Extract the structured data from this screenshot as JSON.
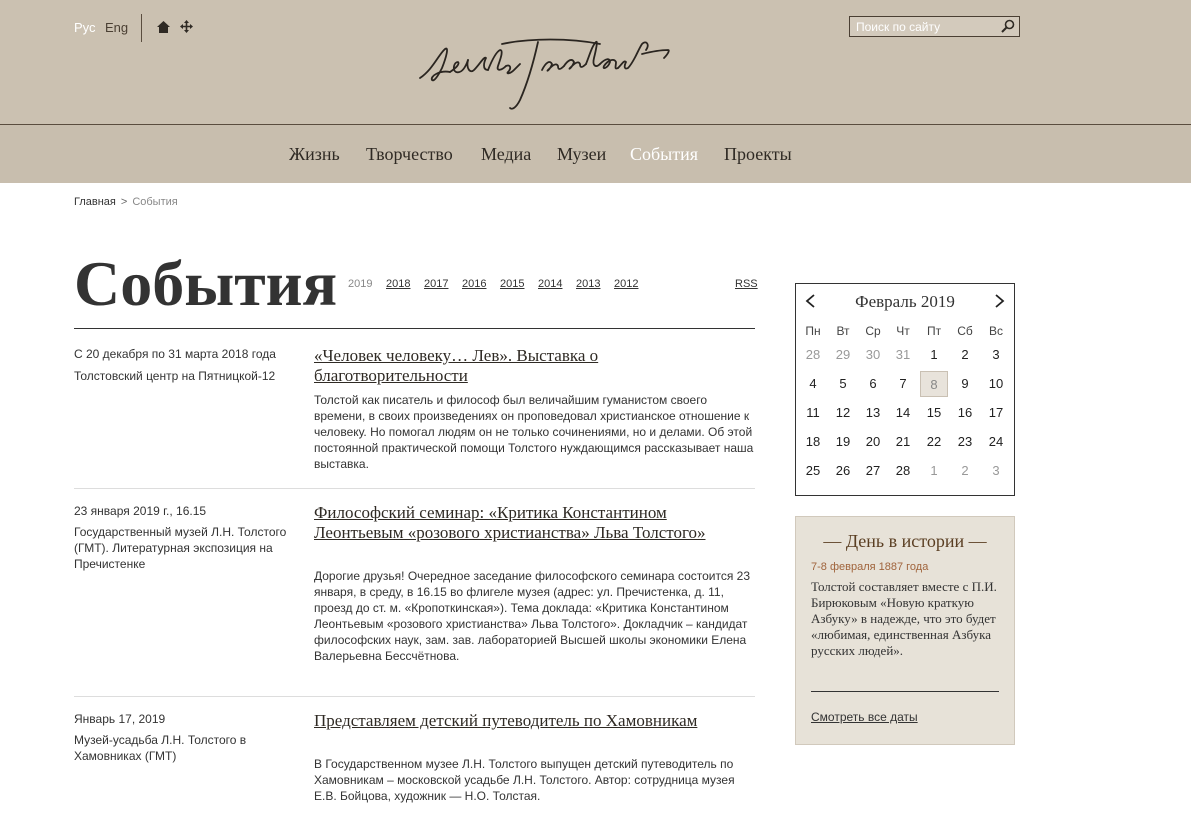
{
  "header": {
    "lang_ru": "Рус",
    "lang_en": "Eng",
    "search_placeholder": "Поиск по сайту"
  },
  "nav": {
    "items": [
      {
        "label": "Жизнь"
      },
      {
        "label": "Творчество"
      },
      {
        "label": "Медиа"
      },
      {
        "label": "Музеи"
      },
      {
        "label": "События",
        "active": true
      },
      {
        "label": "Проекты"
      }
    ]
  },
  "breadcrumb": {
    "home": "Главная",
    "separator": ">",
    "current": "События"
  },
  "page": {
    "title": "События",
    "years": [
      "2019",
      "2018",
      "2017",
      "2016",
      "2015",
      "2014",
      "2013",
      "2012"
    ],
    "rss": "RSS"
  },
  "events": [
    {
      "date": "С 20 декабря по 31 марта 2018 года",
      "place": "Толстовский центр на Пятницкой-12",
      "title": "«Человек человеку… Лев». Выставка о благотворительности",
      "description": "Толстой как писатель и философ  был величайшим гуманистом своего времени, в своих произведениях он проповедовал христианское отношение к человеку. Но помогал людям он не только сочинениями, но и делами. Об этой постоянной практической помощи Толстого нуждающимся рассказывает наша выставка."
    },
    {
      "date": "23 января 2019 г., 16.15",
      "place": "Государственный музей Л.Н. Толстого (ГМТ). Литературная экспозиция на Пречистенке",
      "title": "Философский семинар: «Критика Константином Леонтьевым «розового христианства» Льва Толстого»",
      "description": "Дорогие друзья! Очередное заседание философского семинара состоится 23 января, в среду, в 16.15 во флигеле музея (адрес: ул. Пречистенка, д. 11, проезд до ст. м. «Кропоткинская»). Тема доклада: «Критика Константином Леонтьевым «розового христианства» Льва Толстого». Докладчик – кандидат философских наук, зам. зав. лабораторией Высшей школы экономики Елена Валерьевна Бессчётнова."
    },
    {
      "date": "Январь 17, 2019",
      "place": "Музей-усадьба Л.Н. Толстого в Хамовниках (ГМТ)",
      "title": "Представляем детский путеводитель по Хамовникам",
      "description": "В Государственном музее Л.Н. Толстого выпущен детский путеводитель по Хамовникам – московской усадьбе Л.Н. Толстого. Автор: сотрудница музея Е.В. Бойцова, художник — Н.О. Толстая."
    }
  ],
  "calendar": {
    "month": "Февраль 2019",
    "weekdays": [
      "Пн",
      "Вт",
      "Ср",
      "Чт",
      "Пт",
      "Сб",
      "Вс"
    ],
    "weeks": [
      [
        {
          "d": "28",
          "m": true
        },
        {
          "d": "29",
          "m": true
        },
        {
          "d": "30",
          "m": true
        },
        {
          "d": "31",
          "m": true
        },
        {
          "d": "1"
        },
        {
          "d": "2"
        },
        {
          "d": "3"
        }
      ],
      [
        {
          "d": "4"
        },
        {
          "d": "5"
        },
        {
          "d": "6"
        },
        {
          "d": "7"
        },
        {
          "d": "8",
          "today": true
        },
        {
          "d": "9"
        },
        {
          "d": "10"
        }
      ],
      [
        {
          "d": "11"
        },
        {
          "d": "12"
        },
        {
          "d": "13"
        },
        {
          "d": "14"
        },
        {
          "d": "15"
        },
        {
          "d": "16"
        },
        {
          "d": "17"
        }
      ],
      [
        {
          "d": "18"
        },
        {
          "d": "19"
        },
        {
          "d": "20"
        },
        {
          "d": "21"
        },
        {
          "d": "22"
        },
        {
          "d": "23"
        },
        {
          "d": "24"
        }
      ],
      [
        {
          "d": "25"
        },
        {
          "d": "26"
        },
        {
          "d": "27"
        },
        {
          "d": "28"
        },
        {
          "d": "1",
          "m": true
        },
        {
          "d": "2",
          "m": true
        },
        {
          "d": "3",
          "m": true
        }
      ]
    ]
  },
  "history": {
    "title": "— День в истории —",
    "date": "7-8 февраля 1887 года",
    "text": "Толстой составляет вместе с П.И. Бирюковым «Новую краткую Азбуку» в надежде, что это будет «любимая, единственная Азбука русских людей».",
    "link": "Смотреть все даты"
  },
  "colors": {
    "header_bg": "#cbc1b1",
    "nav_active": "#ffffff",
    "history_bg": "#e7e2d8",
    "history_title": "#5a3e22"
  }
}
